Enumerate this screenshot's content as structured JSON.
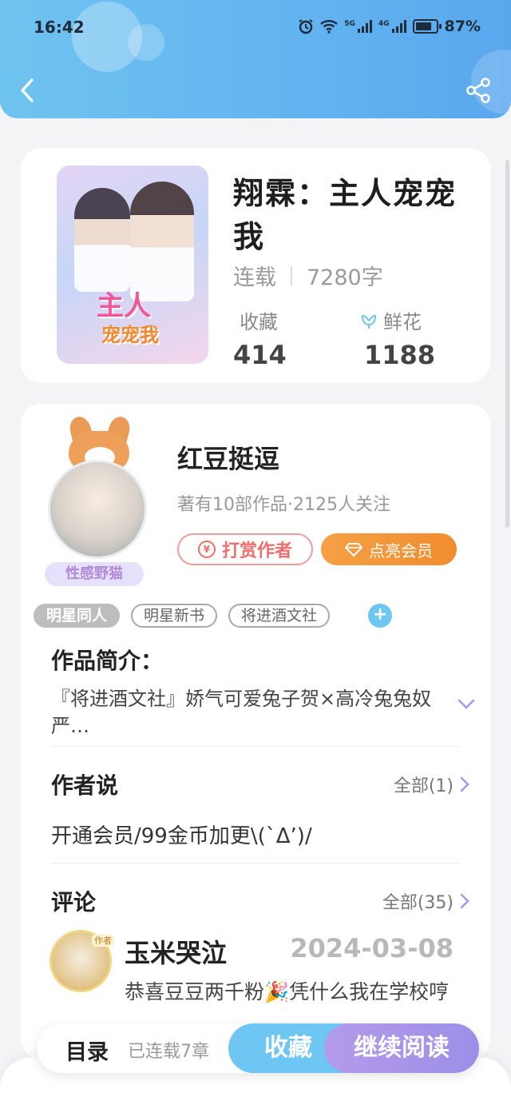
{
  "status_bar": {
    "time": "16:42",
    "net_5g": "5G",
    "net_4g": "4G",
    "battery": "87%"
  },
  "header": {
    "back_icon": "chevron-left-icon",
    "share_icon": "share-icon",
    "gradient_start": "#6fc3ef",
    "gradient_end": "#5aa7ee"
  },
  "book": {
    "cover_title_line1": "主人",
    "cover_title_line2": "宠宠我",
    "title": "翔霖：主人宠宠我",
    "status": "连载",
    "word_count": "7280字",
    "favorites_label": "收藏",
    "favorites_count": "414",
    "flowers_label": "鲜花",
    "flowers_count": "1188"
  },
  "author": {
    "badge": "性感野猫",
    "name": "红豆挺逗",
    "stats": "著有10部作品·2125人关注",
    "tip_button": "打赏作者",
    "tip_coin": "¥",
    "vip_button": "点亮会员"
  },
  "tags": [
    "明星同人",
    "明星新书",
    "将进酒文社"
  ],
  "tag_add": "+",
  "intro": {
    "title": "作品简介：",
    "text": "『将进酒文社』娇气可爱兔子贺×高冷兔兔奴严…"
  },
  "author_says": {
    "title": "作者说",
    "more": "全部(1)",
    "text": "开通会员/99金币加更\\(`Δ’)/"
  },
  "comments": {
    "title": "评论",
    "more": "全部(35)",
    "items": [
      {
        "avatar_tag": "作者",
        "user": "玉米哭泣",
        "date": "2024-03-08",
        "text": "恭喜豆豆两千粉🎉凭什么我在学校哼"
      }
    ]
  },
  "action_bar": {
    "toc": "目录",
    "chapters": "已连载7章",
    "favorite": "收藏",
    "continue": "继续阅读"
  },
  "colors": {
    "accent_blue": "#6ec7f2",
    "accent_purple": "#a997ea",
    "vip_orange": "#f08c2e",
    "tip_red": "#ee6e6e"
  }
}
